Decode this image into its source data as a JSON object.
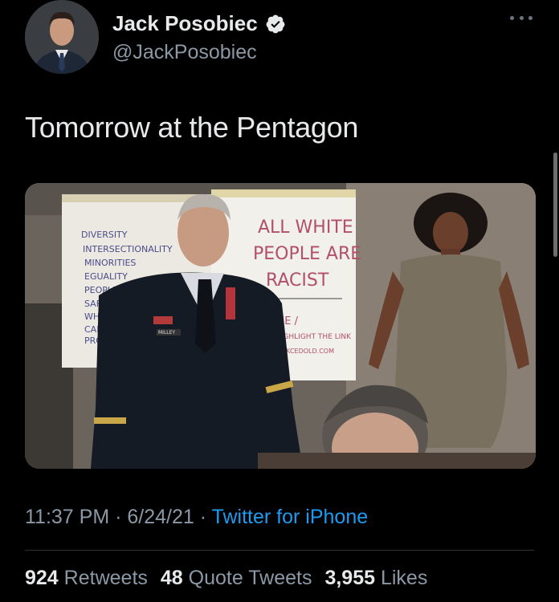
{
  "author": {
    "display_name": "Jack Posobiec",
    "handle": "@JackPosobiec",
    "verified": true
  },
  "tweet": {
    "text": "Tomorrow at the Pentagon",
    "time": "11:37 PM",
    "date": "6/24/21",
    "source": "Twitter for iPhone"
  },
  "stats": {
    "retweets_count": "924",
    "retweets_label": "Retweets",
    "quotes_count": "48",
    "quotes_label": "Quote Tweets",
    "likes_count": "3,955",
    "likes_label": "Likes"
  },
  "media": {
    "board_left_lines": [
      "DIVERSITY",
      "INTERSECTIONALITY",
      "MINORITIES",
      "EGUALITY",
      "PEOPLE",
      "SAFE",
      "WHITE",
      "CAP",
      "PRO"
    ],
    "board_right_lines": [
      "ALL WHITE",
      "PEOPLE ARE",
      "RACIST"
    ],
    "board_bottom_lines": [
      "ME /",
      "HIGHLIGHT THE LINK",
      "JACKCEDOLD.COM"
    ],
    "name_tape": "MILLEY"
  },
  "colors": {
    "background": "#000000",
    "text": "#e7e9ea",
    "muted": "#8b98a5",
    "link": "#1d9bf0",
    "verified_badge": "#e7e9ea"
  },
  "icons": [
    "avatar",
    "verified-badge-icon",
    "more-options-icon"
  ]
}
